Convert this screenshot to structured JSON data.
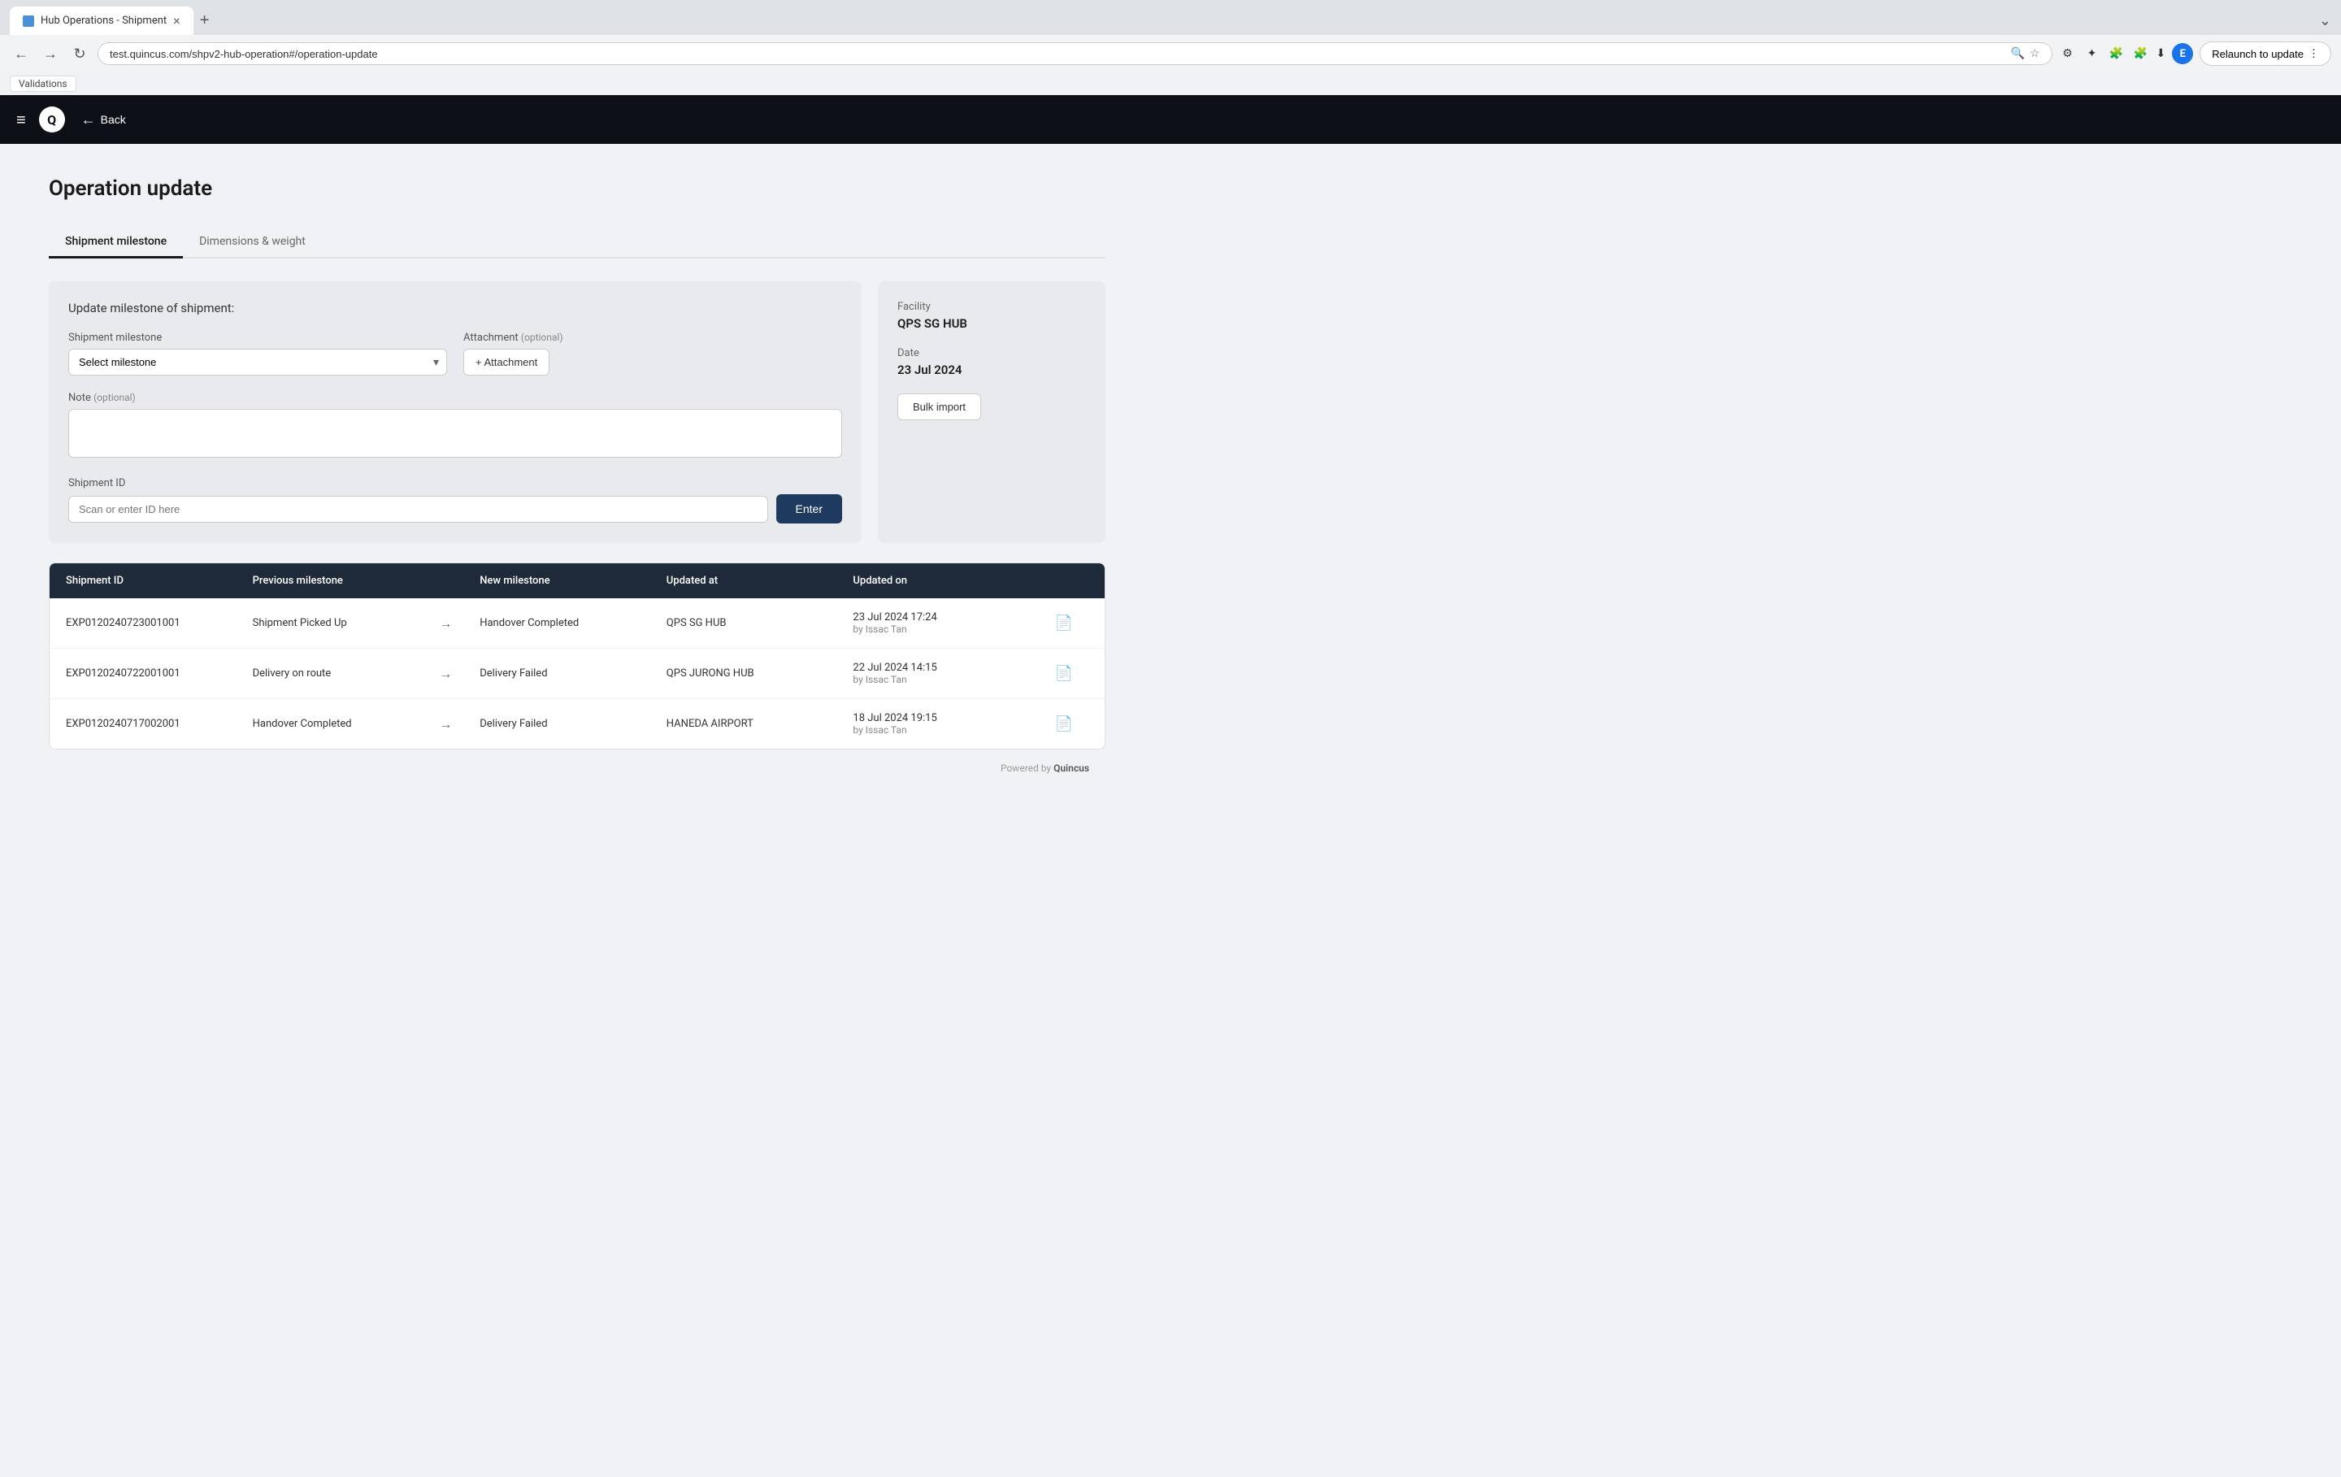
{
  "browser": {
    "tab_title": "Hub Operations - Shipment",
    "tab_close": "×",
    "new_tab_icon": "+",
    "tab_end_icon": "⌄",
    "url": "test.quincus.com/shpv2-hub-operation#/operation-update",
    "back_icon": "←",
    "forward_icon": "→",
    "refresh_icon": "↻",
    "search_icon": "🔍",
    "star_icon": "☆",
    "download_icon": "↓",
    "profile_letter": "E",
    "relaunch_label": "Relaunch to update",
    "relaunch_more": "⋮",
    "validations_tag": "Validations"
  },
  "app": {
    "hamburger_icon": "≡",
    "logo": "Q",
    "back_label": "Back",
    "back_arrow": "←"
  },
  "page": {
    "title": "Operation update",
    "tabs": [
      {
        "label": "Shipment milestone",
        "active": true
      },
      {
        "label": "Dimensions & weight",
        "active": false
      }
    ]
  },
  "form": {
    "section_title": "Update milestone of shipment:",
    "milestone_label": "Shipment milestone",
    "milestone_placeholder": "Select milestone",
    "attachment_label": "Attachment",
    "attachment_optional": "(optional)",
    "attachment_btn": "+ Attachment",
    "note_label": "Note",
    "note_optional": "(optional)",
    "shipment_id_label": "Shipment ID",
    "shipment_id_placeholder": "Scan or enter ID here",
    "enter_btn": "Enter"
  },
  "sidebar": {
    "facility_label": "Facility",
    "facility_value": "QPS SG HUB",
    "date_label": "Date",
    "date_value": "23 Jul 2024",
    "bulk_import_btn": "Bulk import"
  },
  "table": {
    "headers": [
      "Shipment ID",
      "Previous milestone",
      "",
      "New milestone",
      "Updated at",
      "Updated on",
      ""
    ],
    "rows": [
      {
        "shipment_id": "EXP0120240723001001",
        "previous_milestone": "Shipment Picked Up",
        "arrow": "→",
        "new_milestone": "Handover Completed",
        "updated_at": "QPS SG HUB",
        "updated_on": "23 Jul 2024 17:24",
        "updated_by": "by Issac Tan"
      },
      {
        "shipment_id": "EXP0120240722001001",
        "previous_milestone": "Delivery on route",
        "arrow": "→",
        "new_milestone": "Delivery Failed",
        "updated_at": "QPS JURONG HUB",
        "updated_on": "22 Jul 2024 14:15",
        "updated_by": "by Issac Tan"
      },
      {
        "shipment_id": "EXP0120240717002001",
        "previous_milestone": "Handover Completed",
        "arrow": "→",
        "new_milestone": "Delivery Failed",
        "updated_at": "HANEDA AIRPORT",
        "updated_on": "18 Jul 2024 19:15",
        "updated_by": "by Issac Tan"
      }
    ]
  },
  "footer": {
    "text": "Powered by ",
    "brand": "Quincus"
  }
}
